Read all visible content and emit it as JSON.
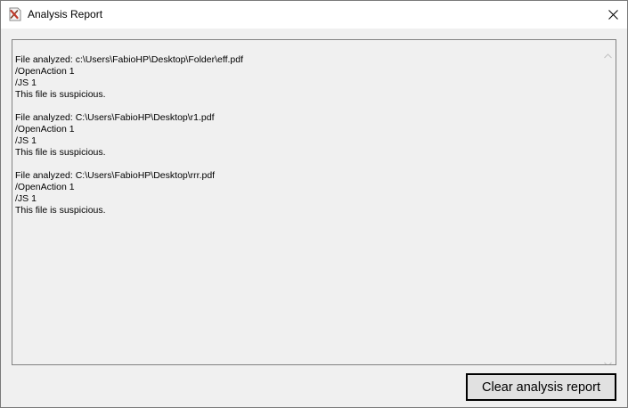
{
  "window": {
    "title": "Analysis Report",
    "app_icon": "pdf-analyzer-icon",
    "close_icon": "close-icon"
  },
  "report": {
    "entries": [
      {
        "file_line": "File analyzed: c:\\Users\\FabioHP\\Desktop\\Folder\\eff.pdf",
        "open_action": "/OpenAction 1",
        "js": "/JS 1",
        "verdict": "This file is suspicious."
      },
      {
        "file_line": "File analyzed: C:\\Users\\FabioHP\\Desktop\\r1.pdf",
        "open_action": "/OpenAction 1",
        "js": "/JS 1",
        "verdict": "This file is suspicious."
      },
      {
        "file_line": "File analyzed: C:\\Users\\FabioHP\\Desktop\\rrr.pdf",
        "open_action": "/OpenAction 1",
        "js": "/JS 1",
        "verdict": "This file is suspicious."
      }
    ],
    "scroll_up_icon": "scroll-up-arrow-icon",
    "scroll_down_icon": "scroll-down-arrow-icon"
  },
  "actions": {
    "clear_label": "Clear analysis report"
  }
}
